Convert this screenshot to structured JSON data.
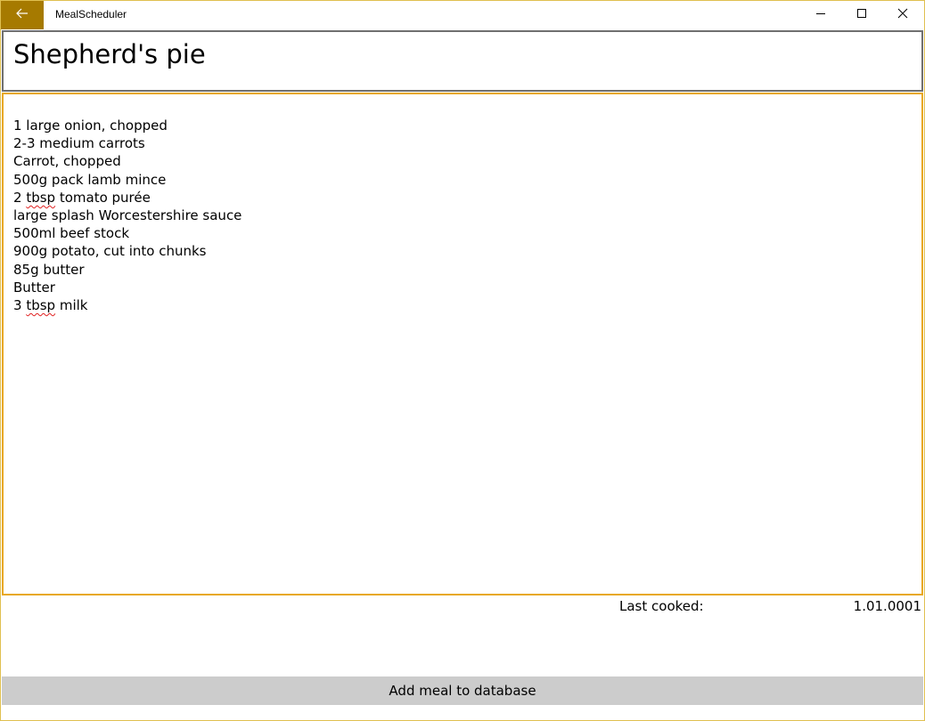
{
  "app": {
    "title": "MealScheduler",
    "accent_color": "#a67a00",
    "back_icon": "arrow-left-icon"
  },
  "window_controls": {
    "minimize_icon": "minimize-icon",
    "maximize_icon": "maximize-icon",
    "close_icon": "close-icon"
  },
  "meal": {
    "title": "Shepherd's pie",
    "ingredients": [
      {
        "text": "1 large onion, chopped"
      },
      {
        "text": "2-3 medium carrots"
      },
      {
        "text": "Carrot, chopped"
      },
      {
        "text": "500g pack lamb mince"
      },
      {
        "pre": "2 ",
        "flag": "tbsp",
        "post": " tomato purée"
      },
      {
        "text": "large splash Worcestershire sauce"
      },
      {
        "text": "500ml beef stock"
      },
      {
        "text": "900g potato, cut into chunks"
      },
      {
        "text": "85g butter"
      },
      {
        "text": "Butter"
      },
      {
        "pre": "3 ",
        "flag": "tbsp",
        "post": " milk"
      }
    ],
    "last_cooked_label": "Last cooked:",
    "last_cooked_value": "1.01.0001"
  },
  "actions": {
    "add_label": "Add meal to database"
  },
  "colors": {
    "title_border": "#707070",
    "ingredients_border": "#e8a820",
    "button_bg": "#cccccc",
    "spellcheck": "#e02020"
  }
}
